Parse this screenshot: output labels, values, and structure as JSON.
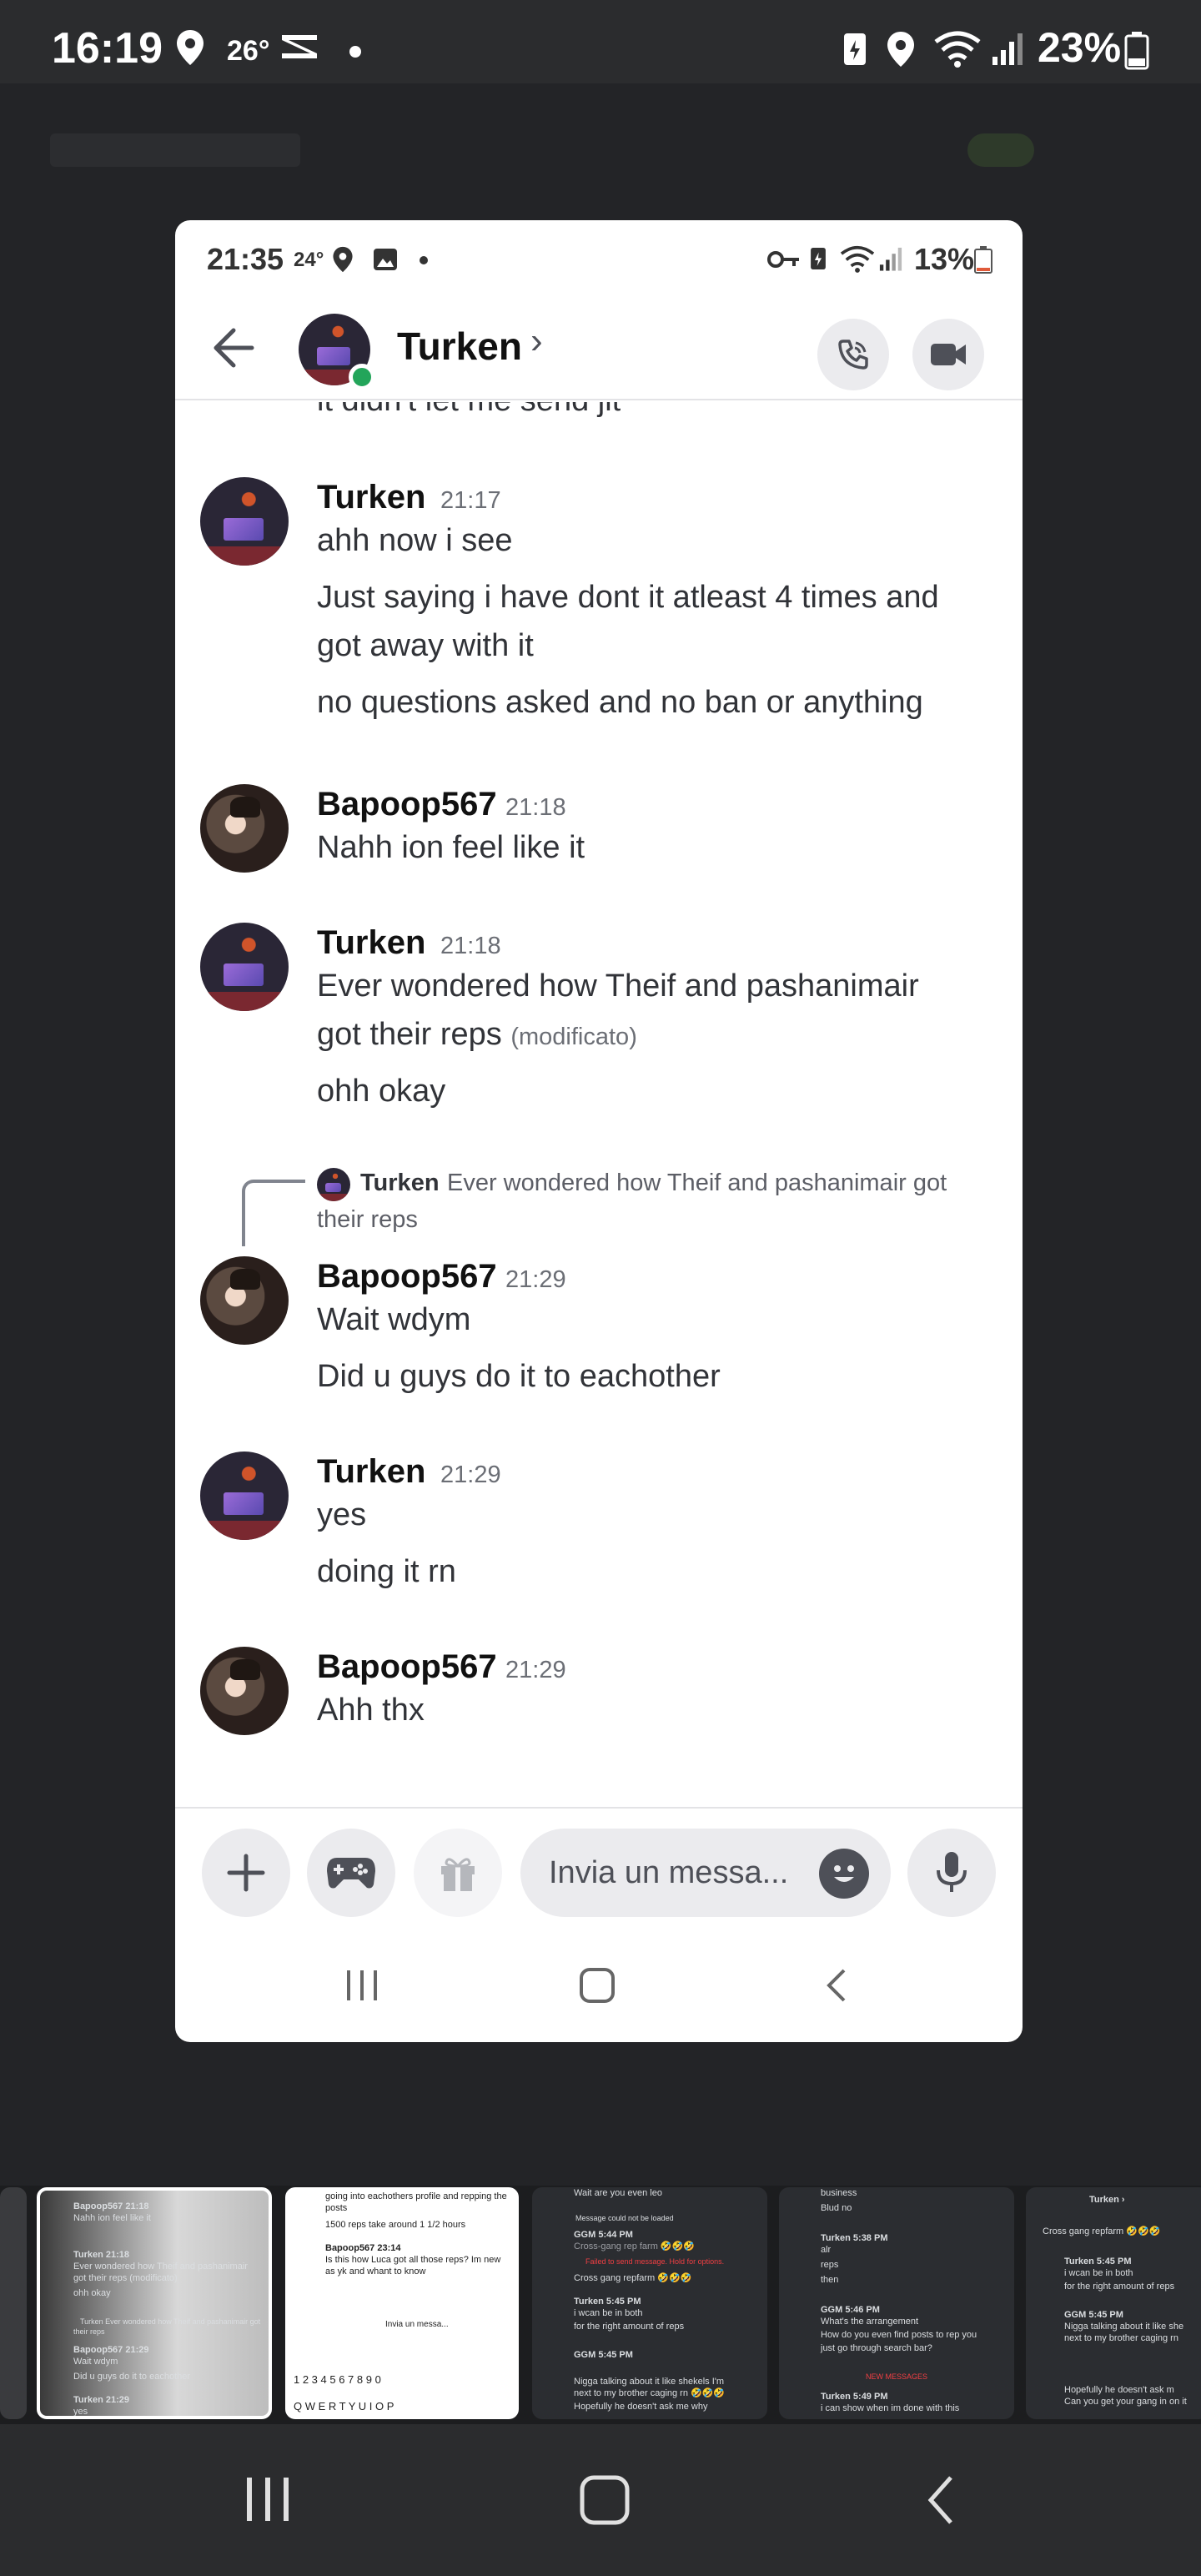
{
  "outer_status": {
    "time": "16:19",
    "temperature": "26°",
    "battery": "23%"
  },
  "inner_status": {
    "time": "21:35",
    "temperature": "24°",
    "battery": "13%"
  },
  "header": {
    "contact_name": "Turken",
    "chevron": "›"
  },
  "clipped_line": "it didn't let me send jit",
  "messages": [
    {
      "author": "Turken",
      "time": "21:17",
      "lines": [
        "ahh now i see",
        "Just saying i have dont it atleast 4 times and",
        "got away with it",
        "no questions asked and no ban or anything"
      ]
    },
    {
      "author": "Bapoop567",
      "time": "21:18",
      "lines": [
        "Nahh ion feel like it"
      ]
    },
    {
      "author": "Turken",
      "time": "21:18",
      "lines": [
        "Ever wondered how Theif and pashanimair",
        "got their reps",
        "ohh okay"
      ],
      "edited": "(modificato)"
    },
    {
      "author": "Bapoop567",
      "time": "21:29",
      "lines": [
        "Wait wdym",
        "Did u guys do it to eachother"
      ],
      "reply": {
        "author": "Turken",
        "text_1": "Ever wondered how Theif and pashanimair got",
        "text_2": "their reps"
      }
    },
    {
      "author": "Turken",
      "time": "21:29",
      "lines": [
        "yes",
        "doing it rn"
      ]
    },
    {
      "author": "Bapoop567",
      "time": "21:29",
      "lines": [
        "Ahh thx"
      ]
    }
  ],
  "composer": {
    "placeholder": "Invia un messa..."
  },
  "thumbnails": {
    "t1": [
      "Bapoop567  21:18",
      "Nahh ion feel like it",
      "Turken  21:18",
      "Ever wondered how Theif and pashanimair",
      "got their reps (modificato)",
      "ohh okay",
      "Turken Ever wondered how Theif and pashanimair got",
      "their reps",
      "Bapoop567  21:29",
      "Wait wdym",
      "Did u guys do it to eachother",
      "Turken  21:29",
      "yes"
    ],
    "t2": [
      "going into eachothers profile and repping the",
      "posts",
      "1500 reps take around 1 1/2 hours",
      "Bapoop567  23:14",
      "Is this how Luca got all those reps? Im new",
      "as yk and whant to know",
      "Invia un messa...",
      "1 2 3 4 5 6 7 8 9 0",
      "Q W E R T Y U I O P"
    ],
    "t3": [
      "Wait are you even leo",
      "Message could not be loaded",
      "GGM  5:44 PM",
      "Cross-gang rep farm 🤣🤣🤣",
      "Failed to send message. Hold for options.",
      "Cross gang repfarm 🤣🤣🤣",
      "Turken  5:45 PM",
      "i wcan be in both",
      "for the right amount of reps",
      "GGM  5:45 PM",
      "Nigga talking about it like shekels I'm",
      "next to my brother caging rn 🤣🤣🤣",
      "Hopefully he doesn't ask me why"
    ],
    "t4": [
      "business",
      "Blud no",
      "Turken  5:38 PM",
      "alr",
      "reps",
      "then",
      "GGM  5:46 PM",
      "What's the arrangement",
      "How do you even find posts to rep you",
      "just go through search bar?",
      "NEW MESSAGES",
      "Turken  5:49 PM",
      "i can show when im done with this"
    ],
    "t5": [
      "Turken ›",
      "Cross gang repfarm 🤣🤣🤣",
      "Turken  5:45 PM",
      "i wcan be in both",
      "for the right amount of reps",
      "GGM  5:45 PM",
      "Nigga talking about it like she",
      "next to my brother caging rn",
      "Hopefully he doesn't ask m",
      "Can you get your gang in on it"
    ]
  }
}
